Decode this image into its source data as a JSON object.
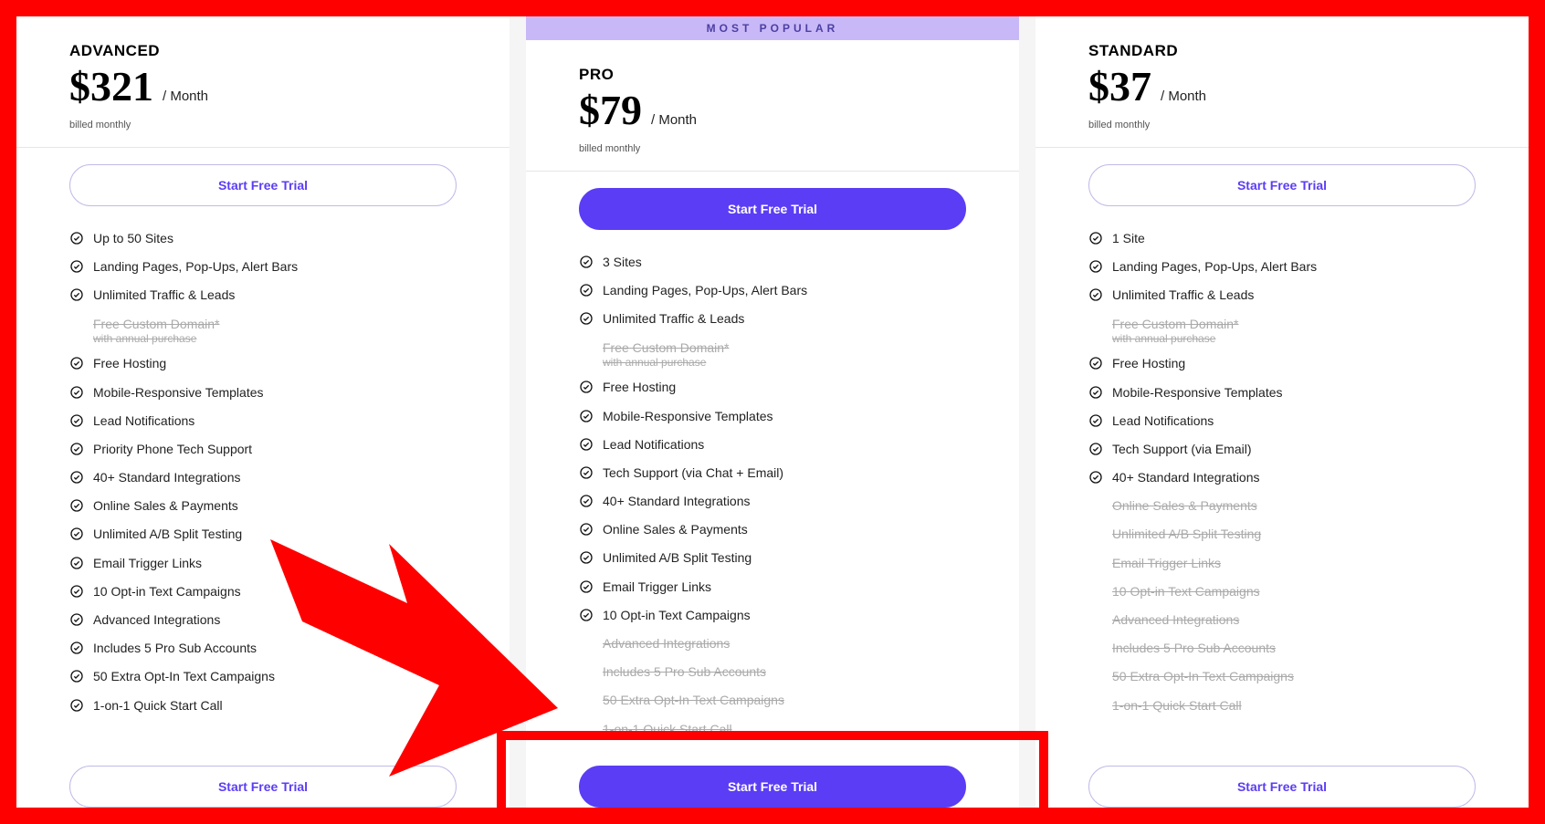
{
  "common": {
    "period": "/ Month",
    "billed": "billed monthly",
    "cta": "Start Free Trial",
    "most_popular": "MOST POPULAR"
  },
  "plans": [
    {
      "id": "advanced",
      "name": "ADVANCED",
      "price": "$321",
      "featured": false,
      "features": [
        {
          "text": "Up to 50 Sites",
          "enabled": true
        },
        {
          "text": "Landing Pages, Pop-Ups, Alert Bars",
          "enabled": true
        },
        {
          "text": "Unlimited Traffic & Leads",
          "enabled": true
        },
        {
          "text": "Free Custom Domain*",
          "sub": "with annual purchase",
          "enabled": false
        },
        {
          "text": "Free Hosting",
          "enabled": true
        },
        {
          "text": "Mobile-Responsive Templates",
          "enabled": true
        },
        {
          "text": "Lead Notifications",
          "enabled": true
        },
        {
          "text": "Priority Phone Tech Support",
          "enabled": true
        },
        {
          "text": "40+ Standard Integrations",
          "enabled": true
        },
        {
          "text": "Online Sales & Payments",
          "enabled": true
        },
        {
          "text": "Unlimited A/B Split Testing",
          "enabled": true
        },
        {
          "text": "Email Trigger Links",
          "enabled": true
        },
        {
          "text": "10 Opt-in Text Campaigns",
          "enabled": true
        },
        {
          "text": "Advanced Integrations",
          "enabled": true
        },
        {
          "text": "Includes 5 Pro Sub Accounts",
          "enabled": true
        },
        {
          "text": "50 Extra Opt-In Text Campaigns",
          "enabled": true
        },
        {
          "text": "1-on-1 Quick Start Call",
          "enabled": true
        }
      ]
    },
    {
      "id": "pro",
      "name": "PRO",
      "price": "$79",
      "featured": true,
      "features": [
        {
          "text": "3 Sites",
          "enabled": true
        },
        {
          "text": "Landing Pages, Pop-Ups, Alert Bars",
          "enabled": true
        },
        {
          "text": "Unlimited Traffic & Leads",
          "enabled": true
        },
        {
          "text": "Free Custom Domain*",
          "sub": "with annual purchase",
          "enabled": false
        },
        {
          "text": "Free Hosting",
          "enabled": true
        },
        {
          "text": "Mobile-Responsive Templates",
          "enabled": true
        },
        {
          "text": "Lead Notifications",
          "enabled": true
        },
        {
          "text": "Tech Support (via Chat + Email)",
          "enabled": true
        },
        {
          "text": "40+ Standard Integrations",
          "enabled": true
        },
        {
          "text": "Online Sales & Payments",
          "enabled": true
        },
        {
          "text": "Unlimited A/B Split Testing",
          "enabled": true
        },
        {
          "text": "Email Trigger Links",
          "enabled": true
        },
        {
          "text": "10 Opt-in Text Campaigns",
          "enabled": true
        },
        {
          "text": "Advanced Integrations",
          "enabled": false
        },
        {
          "text": "Includes 5 Pro Sub Accounts",
          "enabled": false
        },
        {
          "text": "50 Extra Opt-In Text Campaigns",
          "enabled": false
        },
        {
          "text": "1-on-1 Quick Start Call",
          "enabled": false
        }
      ]
    },
    {
      "id": "standard",
      "name": "STANDARD",
      "price": "$37",
      "featured": false,
      "features": [
        {
          "text": "1 Site",
          "enabled": true
        },
        {
          "text": "Landing Pages, Pop-Ups, Alert Bars",
          "enabled": true
        },
        {
          "text": "Unlimited Traffic & Leads",
          "enabled": true
        },
        {
          "text": "Free Custom Domain*",
          "sub": "with annual purchase",
          "enabled": false
        },
        {
          "text": "Free Hosting",
          "enabled": true
        },
        {
          "text": "Mobile-Responsive Templates",
          "enabled": true
        },
        {
          "text": "Lead Notifications",
          "enabled": true
        },
        {
          "text": "Tech Support (via Email)",
          "enabled": true
        },
        {
          "text": "40+ Standard Integrations",
          "enabled": true
        },
        {
          "text": "Online Sales & Payments",
          "enabled": false
        },
        {
          "text": "Unlimited A/B Split Testing",
          "enabled": false
        },
        {
          "text": "Email Trigger Links",
          "enabled": false
        },
        {
          "text": "10 Opt-in Text Campaigns",
          "enabled": false
        },
        {
          "text": "Advanced Integrations",
          "enabled": false
        },
        {
          "text": "Includes 5 Pro Sub Accounts",
          "enabled": false
        },
        {
          "text": "50 Extra Opt-In Text Campaigns",
          "enabled": false
        },
        {
          "text": "1-on-1 Quick Start Call",
          "enabled": false
        }
      ]
    }
  ],
  "annotation": {
    "arrow_color": "#ff0000",
    "highlight_target": "pro-bottom-cta"
  }
}
